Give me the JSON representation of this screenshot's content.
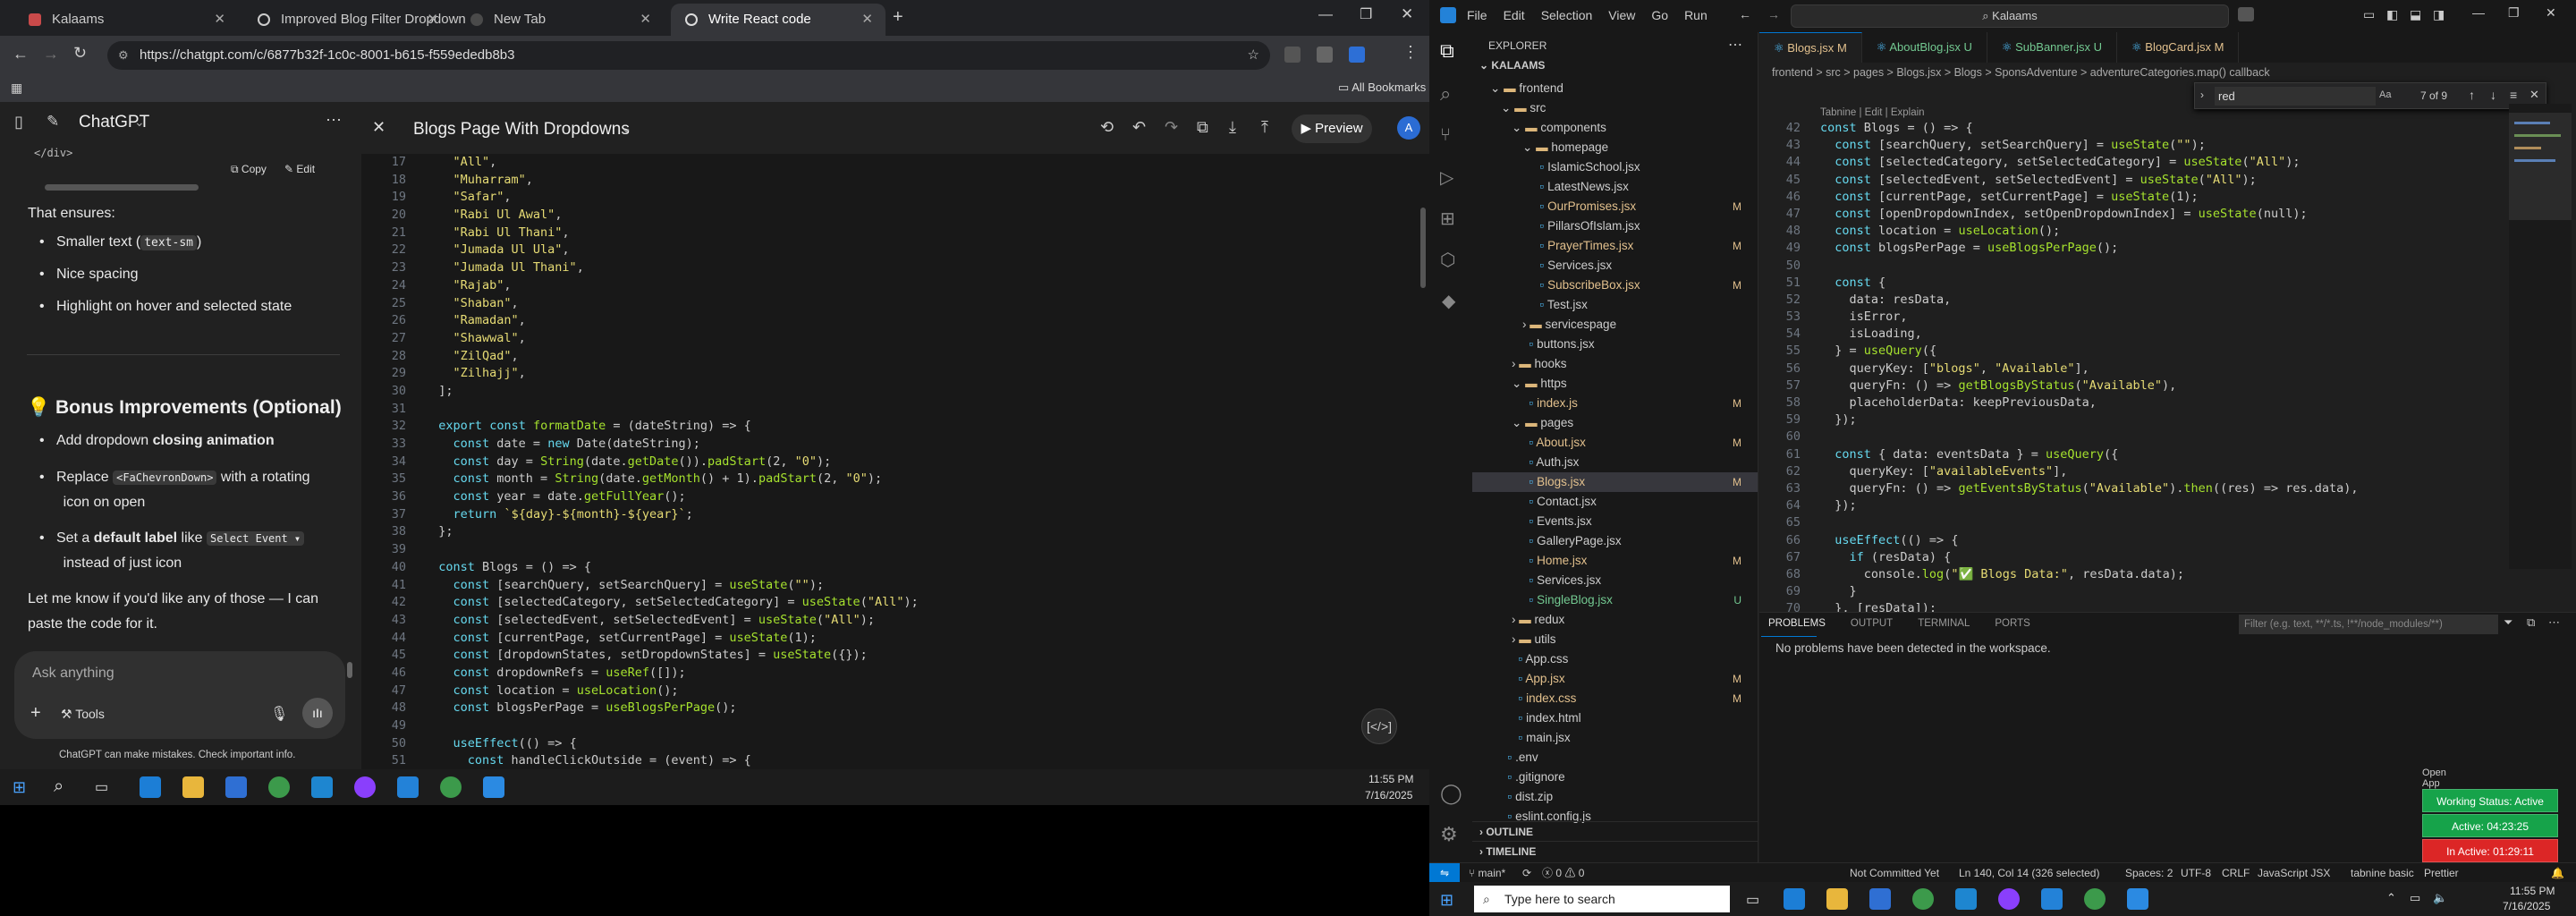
{
  "browser": {
    "tabs": [
      {
        "label": "Kalaams"
      },
      {
        "label": "Improved Blog Filter Dropdown"
      },
      {
        "label": "New Tab"
      },
      {
        "label": "Write React code"
      }
    ],
    "url": "https://chatgpt.com/c/6877b32f-1c0c-8001-b615-f559ededb8b3",
    "bookmarks_label": "All Bookmarks"
  },
  "chat": {
    "app_title": "ChatGPT",
    "code_tail": "</div>",
    "copy_label": "Copy",
    "edit_label": "Edit",
    "ensures_text": "That ensures:",
    "ensures_items": [
      "Smaller text (text-sm)",
      "Nice spacing",
      "Highlight on hover and selected state"
    ],
    "bonus_heading": "Bonus Improvements (Optional)",
    "bonus_items": [
      "Add dropdown closing animation",
      "Replace <FaChevronDown> with a rotating icon on open",
      "Set a default label like Select Event ▾ instead of just icon"
    ],
    "closing_text": "Let me know if you'd like any of those — I can paste the code for it.",
    "input_placeholder": "Ask anything",
    "tools_label": "Tools",
    "disclaimer": "ChatGPT can make mistakes. Check important info."
  },
  "canvas": {
    "title": "Blogs Page With Dropdowns",
    "preview_label": "Preview",
    "avatar_letter": "A"
  },
  "code_lines": [
    {
      "n": "17",
      "t": "    \"All\","
    },
    {
      "n": "18",
      "t": "    \"Muharram\","
    },
    {
      "n": "19",
      "t": "    \"Safar\","
    },
    {
      "n": "20",
      "t": "    \"Rabi Ul Awal\","
    },
    {
      "n": "21",
      "t": "    \"Rabi Ul Thani\","
    },
    {
      "n": "22",
      "t": "    \"Jumada Ul Ula\","
    },
    {
      "n": "23",
      "t": "    \"Jumada Ul Thani\","
    },
    {
      "n": "24",
      "t": "    \"Rajab\","
    },
    {
      "n": "25",
      "t": "    \"Shaban\","
    },
    {
      "n": "26",
      "t": "    \"Ramadan\","
    },
    {
      "n": "27",
      "t": "    \"Shawwal\","
    },
    {
      "n": "28",
      "t": "    \"ZilQad\","
    },
    {
      "n": "29",
      "t": "    \"Zilhajj\","
    },
    {
      "n": "30",
      "t": "  ];"
    },
    {
      "n": "31",
      "t": ""
    },
    {
      "n": "32",
      "t": "  export const formatDate = (dateString) => {"
    },
    {
      "n": "33",
      "t": "    const date = new Date(dateString);"
    },
    {
      "n": "34",
      "t": "    const day = String(date.getDate()).padStart(2, \"0\");"
    },
    {
      "n": "35",
      "t": "    const month = String(date.getMonth() + 1).padStart(2, \"0\");"
    },
    {
      "n": "36",
      "t": "    const year = date.getFullYear();"
    },
    {
      "n": "37",
      "t": "    return `${day}-${month}-${year}`;"
    },
    {
      "n": "38",
      "t": "  };"
    },
    {
      "n": "39",
      "t": ""
    },
    {
      "n": "40",
      "t": "  const Blogs = () => {"
    },
    {
      "n": "41",
      "t": "    const [searchQuery, setSearchQuery] = useState(\"\");"
    },
    {
      "n": "42",
      "t": "    const [selectedCategory, setSelectedCategory] = useState(\"All\");"
    },
    {
      "n": "43",
      "t": "    const [selectedEvent, setSelectedEvent] = useState(\"All\");"
    },
    {
      "n": "44",
      "t": "    const [currentPage, setCurrentPage] = useState(1);"
    },
    {
      "n": "45",
      "t": "    const [dropdownStates, setDropdownStates] = useState({});"
    },
    {
      "n": "46",
      "t": "    const dropdownRefs = useRef([]);"
    },
    {
      "n": "47",
      "t": "    const location = useLocation();"
    },
    {
      "n": "48",
      "t": "    const blogsPerPage = useBlogsPerPage();"
    },
    {
      "n": "49",
      "t": ""
    },
    {
      "n": "50",
      "t": "    useEffect(() => {"
    },
    {
      "n": "51",
      "t": "      const handleClickOutside = (event) => {"
    }
  ],
  "taskbar_left": {
    "time": "11:55 PM",
    "date": "7/16/2025"
  },
  "vscode": {
    "menu": [
      "File",
      "Edit",
      "Selection",
      "View",
      "Go",
      "Run"
    ],
    "search_box": "Kalaams",
    "explorer_title": "EXPLORER",
    "project": "KALAAMS",
    "tabs": [
      {
        "label": "Blogs.jsx",
        "status": "M"
      },
      {
        "label": "AboutBlog.jsx",
        "status": "U"
      },
      {
        "label": "SubBanner.jsx",
        "status": "U"
      },
      {
        "label": "BlogCard.jsx",
        "status": "M"
      }
    ],
    "breadcrumb": "frontend > src > pages > Blogs.jsx > Blogs > SponsAdventure > adventureCategories.map() callback",
    "find": {
      "query": "red",
      "result": "7 of 9"
    },
    "codelens": "Tabnine | Edit | Explain",
    "tree": [
      {
        "label": "frontend",
        "depth": 1,
        "type": "folder-open",
        "status": ""
      },
      {
        "label": "src",
        "depth": 2,
        "type": "folder-open",
        "status": ""
      },
      {
        "label": "components",
        "depth": 3,
        "type": "folder-open",
        "status": ""
      },
      {
        "label": "homepage",
        "depth": 4,
        "type": "folder-open",
        "status": ""
      },
      {
        "label": "IslamicSchool.jsx",
        "depth": 5,
        "type": "file",
        "status": ""
      },
      {
        "label": "LatestNews.jsx",
        "depth": 5,
        "type": "file",
        "status": ""
      },
      {
        "label": "OurPromises.jsx",
        "depth": 5,
        "type": "file",
        "status": "M"
      },
      {
        "label": "PillarsOfIslam.jsx",
        "depth": 5,
        "type": "file",
        "status": ""
      },
      {
        "label": "PrayerTimes.jsx",
        "depth": 5,
        "type": "file",
        "status": "M"
      },
      {
        "label": "Services.jsx",
        "depth": 5,
        "type": "file",
        "status": ""
      },
      {
        "label": "SubscribeBox.jsx",
        "depth": 5,
        "type": "file",
        "status": "M"
      },
      {
        "label": "Test.jsx",
        "depth": 5,
        "type": "file",
        "status": ""
      },
      {
        "label": "servicespage",
        "depth": 4,
        "type": "folder",
        "status": ""
      },
      {
        "label": "buttons.jsx",
        "depth": 4,
        "type": "file",
        "status": ""
      },
      {
        "label": "hooks",
        "depth": 3,
        "type": "folder",
        "status": ""
      },
      {
        "label": "https",
        "depth": 3,
        "type": "folder-open",
        "status": ""
      },
      {
        "label": "index.js",
        "depth": 4,
        "type": "file",
        "status": "M"
      },
      {
        "label": "pages",
        "depth": 3,
        "type": "folder-open",
        "status": ""
      },
      {
        "label": "About.jsx",
        "depth": 4,
        "type": "file",
        "status": "M"
      },
      {
        "label": "Auth.jsx",
        "depth": 4,
        "type": "file",
        "status": ""
      },
      {
        "label": "Blogs.jsx",
        "depth": 4,
        "type": "file",
        "status": "M"
      },
      {
        "label": "Contact.jsx",
        "depth": 4,
        "type": "file",
        "status": ""
      },
      {
        "label": "Events.jsx",
        "depth": 4,
        "type": "file",
        "status": ""
      },
      {
        "label": "GalleryPage.jsx",
        "depth": 4,
        "type": "file",
        "status": ""
      },
      {
        "label": "Home.jsx",
        "depth": 4,
        "type": "file",
        "status": "M"
      },
      {
        "label": "Services.jsx",
        "depth": 4,
        "type": "file",
        "status": ""
      },
      {
        "label": "SingleBlog.jsx",
        "depth": 4,
        "type": "file",
        "status": "U"
      },
      {
        "label": "redux",
        "depth": 3,
        "type": "folder",
        "status": ""
      },
      {
        "label": "utils",
        "depth": 3,
        "type": "folder",
        "status": ""
      },
      {
        "label": "App.css",
        "depth": 3,
        "type": "file",
        "status": ""
      },
      {
        "label": "App.jsx",
        "depth": 3,
        "type": "file",
        "status": "M"
      },
      {
        "label": "index.css",
        "depth": 3,
        "type": "file",
        "status": "M"
      },
      {
        "label": "index.html",
        "depth": 3,
        "type": "file",
        "status": ""
      },
      {
        "label": "main.jsx",
        "depth": 3,
        "type": "file",
        "status": ""
      },
      {
        "label": ".env",
        "depth": 2,
        "type": "file",
        "status": ""
      },
      {
        "label": ".gitignore",
        "depth": 2,
        "type": "file",
        "status": ""
      },
      {
        "label": "dist.zip",
        "depth": 2,
        "type": "file",
        "status": ""
      },
      {
        "label": "eslint.config.js",
        "depth": 2,
        "type": "file",
        "status": ""
      }
    ],
    "outline_label": "OUTLINE",
    "timeline_label": "TIMELINE",
    "code_lines": [
      {
        "n": "42",
        "t": "const Blogs = () => {"
      },
      {
        "n": "43",
        "t": "  const [searchQuery, setSearchQuery] = useState(\"\");"
      },
      {
        "n": "44",
        "t": "  const [selectedCategory, setSelectedCategory] = useState(\"All\");"
      },
      {
        "n": "45",
        "t": "  const [selectedEvent, setSelectedEvent] = useState(\"All\");"
      },
      {
        "n": "46",
        "t": "  const [currentPage, setCurrentPage] = useState(1);"
      },
      {
        "n": "47",
        "t": "  const [openDropdownIndex, setOpenDropdownIndex] = useState(null);"
      },
      {
        "n": "48",
        "t": "  const location = useLocation();"
      },
      {
        "n": "49",
        "t": "  const blogsPerPage = useBlogsPerPage();"
      },
      {
        "n": "50",
        "t": ""
      },
      {
        "n": "51",
        "t": "  const {"
      },
      {
        "n": "52",
        "t": "    data: resData,"
      },
      {
        "n": "53",
        "t": "    isError,"
      },
      {
        "n": "54",
        "t": "    isLoading,"
      },
      {
        "n": "55",
        "t": "  } = useQuery({"
      },
      {
        "n": "56",
        "t": "    queryKey: [\"blogs\", \"Available\"],"
      },
      {
        "n": "57",
        "t": "    queryFn: () => getBlogsByStatus(\"Available\"),"
      },
      {
        "n": "58",
        "t": "    placeholderData: keepPreviousData,"
      },
      {
        "n": "59",
        "t": "  });"
      },
      {
        "n": "60",
        "t": ""
      },
      {
        "n": "61",
        "t": "  const { data: eventsData } = useQuery({"
      },
      {
        "n": "62",
        "t": "    queryKey: [\"availableEvents\"],"
      },
      {
        "n": "63",
        "t": "    queryFn: () => getEventsByStatus(\"Available\").then((res) => res.data),"
      },
      {
        "n": "64",
        "t": "  });"
      },
      {
        "n": "65",
        "t": ""
      },
      {
        "n": "66",
        "t": "  useEffect(() => {"
      },
      {
        "n": "67",
        "t": "    if (resData) {"
      },
      {
        "n": "68",
        "t": "      console.log(\"✅ Blogs Data:\", resData.data);"
      },
      {
        "n": "69",
        "t": "    }"
      },
      {
        "n": "70",
        "t": "  }, [resData]);"
      }
    ],
    "panel_tabs": [
      "PROBLEMS",
      "OUTPUT",
      "TERMINAL",
      "PORTS"
    ],
    "filter_placeholder": "Filter (e.g. text, **/*.ts, !**/node_modules/**)",
    "no_problems": "No problems have been detected in the workspace.",
    "status": {
      "branch": "main*",
      "errors": "0",
      "warnings": "0",
      "git": "Not Committed Yet",
      "position": "Ln 140, Col 14 (326 selected)",
      "spaces": "Spaces: 2",
      "encoding": "UTF-8",
      "eol": "CRLF",
      "lang": "JavaScript JSX",
      "tabnine": "tabnine basic",
      "prettier": "Prettier"
    }
  },
  "timers": {
    "open_app": "Open App",
    "working": "Working Status: Active",
    "active": "Active: 04:23:25",
    "inactive": "In Active: 01:29:11"
  },
  "taskbar_right": {
    "search_placeholder": "Type here to search",
    "time": "11:55 PM",
    "date": "7/16/2025"
  },
  "colors": {
    "vscode_accent": "#0078d4",
    "modified": "#e2c08d",
    "untracked": "#73c991",
    "timer_green": "#16a34a",
    "timer_red": "#dc2626"
  }
}
